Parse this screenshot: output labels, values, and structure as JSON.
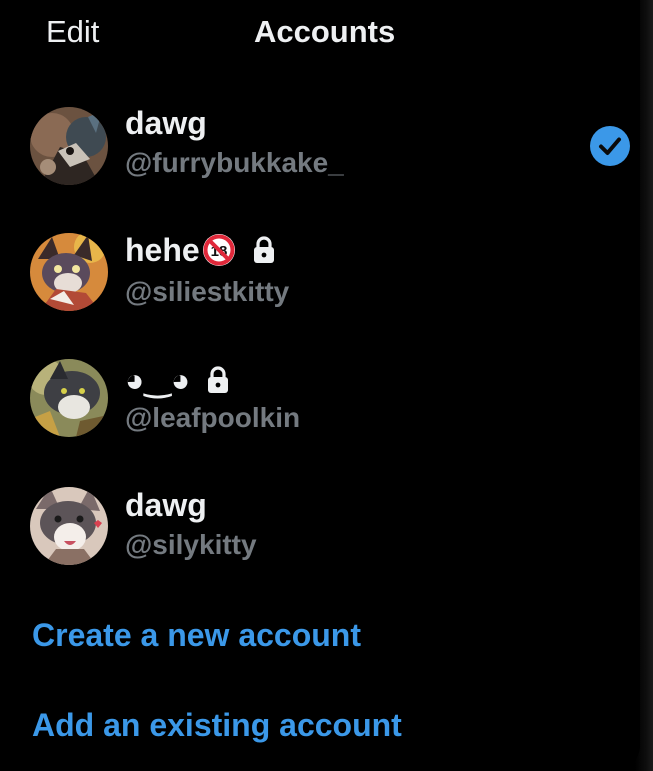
{
  "header": {
    "edit_label": "Edit",
    "title": "Accounts"
  },
  "accounts": [
    {
      "name": "dawg",
      "handle": "@furrybukkake_",
      "selected": true,
      "protected": false,
      "name_badge": ""
    },
    {
      "name": "hehe",
      "handle": "@siliestkitty",
      "selected": false,
      "protected": true,
      "name_badge": "18-prohibited-icon"
    },
    {
      "name": "◕‿◕",
      "handle": "@leafpoolkin",
      "selected": false,
      "protected": true,
      "name_badge": ""
    },
    {
      "name": "dawg",
      "handle": "@silykitty",
      "selected": false,
      "protected": false,
      "name_badge": ""
    }
  ],
  "actions": {
    "create_label": "Create a new account",
    "add_label": "Add an existing account"
  },
  "colors": {
    "background": "#000000",
    "text_primary": "#eef0f2",
    "text_secondary": "#747a80",
    "accent": "#3b98e8",
    "badge_red": "#e0283a"
  }
}
